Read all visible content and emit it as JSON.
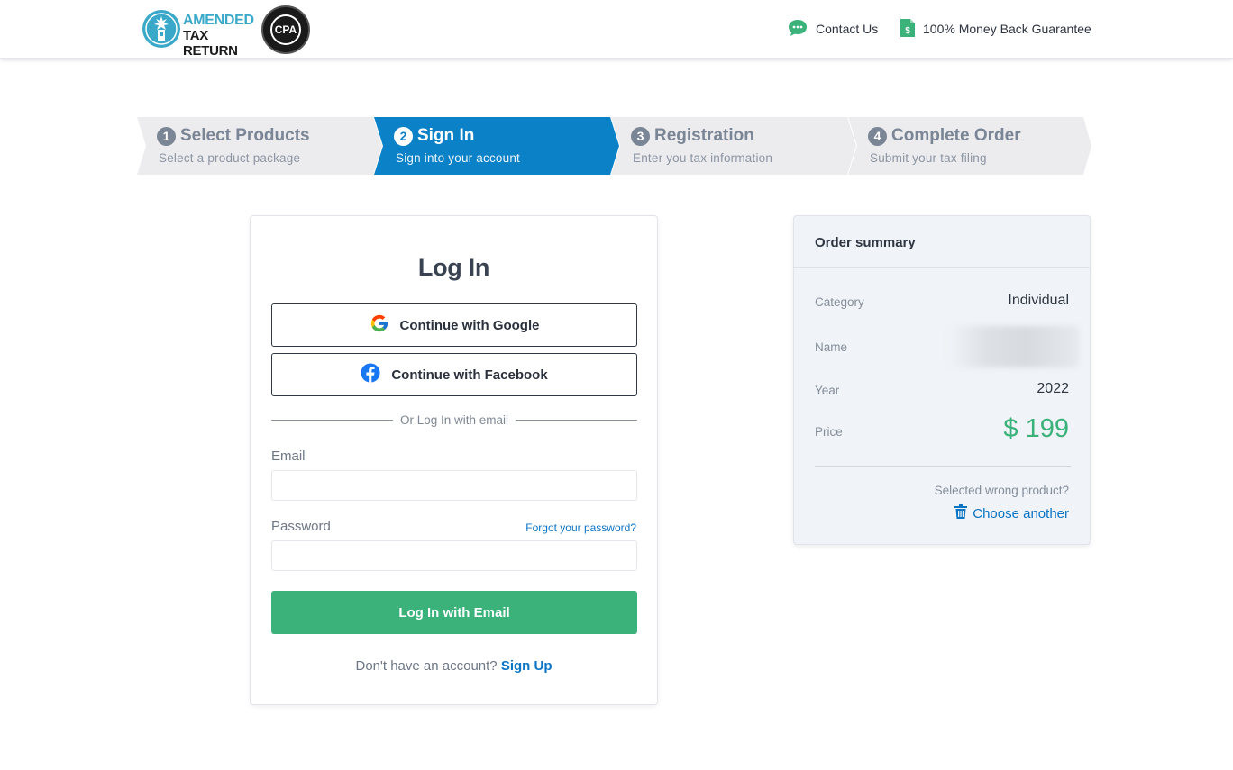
{
  "header": {
    "logo": {
      "line1": "AMENDED",
      "line2": "TAX RETURN",
      "badge": "CPA"
    },
    "contact_label": "Contact Us",
    "guarantee_label": "100% Money Back Guarantee"
  },
  "steps": [
    {
      "number": "1",
      "title": "Select Products",
      "subtitle": "Select a product package",
      "active": false
    },
    {
      "number": "2",
      "title": "Sign In",
      "subtitle": "Sign into your account",
      "active": true
    },
    {
      "number": "3",
      "title": "Registration",
      "subtitle": "Enter you tax information",
      "active": false
    },
    {
      "number": "4",
      "title": "Complete Order",
      "subtitle": "Submit your tax filing",
      "active": false
    }
  ],
  "login": {
    "title": "Log In",
    "google_label": "Continue with Google",
    "facebook_label": "Continue with Facebook",
    "divider_text": "Or Log In with email",
    "email_label": "Email",
    "email_value": "",
    "password_label": "Password",
    "password_value": "",
    "forgot_label": "Forgot your password?",
    "submit_label": "Log In with Email",
    "signup_prompt": "Don't have an account?",
    "signup_label": "Sign Up"
  },
  "summary": {
    "title": "Order summary",
    "category_label": "Category",
    "category_value": "Individual",
    "name_label": "Name",
    "year_label": "Year",
    "year_value": "2022",
    "price_label": "Price",
    "price_value": "$ 199",
    "wrong_product_text": "Selected wrong product?",
    "choose_another_label": "Choose another"
  },
  "colors": {
    "accent_blue": "#0b82c7",
    "success_green": "#3ab27a",
    "link_blue": "#0b74c5",
    "step_inactive_bg": "#ececee"
  }
}
